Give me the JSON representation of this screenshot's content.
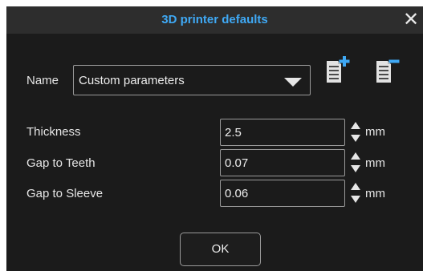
{
  "dialog": {
    "title": "3D printer defaults",
    "close_glyph": "✕",
    "accent_color": "#3fa9f5",
    "background_color": "#1b1b1b"
  },
  "name_row": {
    "label": "Name",
    "selected_value": "Custom parameters",
    "add_icon": "add-parameters-icon",
    "remove_icon": "remove-parameters-icon"
  },
  "fields": [
    {
      "label": "Thickness",
      "value": "2.5",
      "unit": "mm"
    },
    {
      "label": "Gap to Teeth",
      "value": "0.07",
      "unit": "mm"
    },
    {
      "label": "Gap to Sleeve",
      "value": "0.06",
      "unit": "mm"
    }
  ],
  "footer": {
    "ok_label": "OK"
  }
}
